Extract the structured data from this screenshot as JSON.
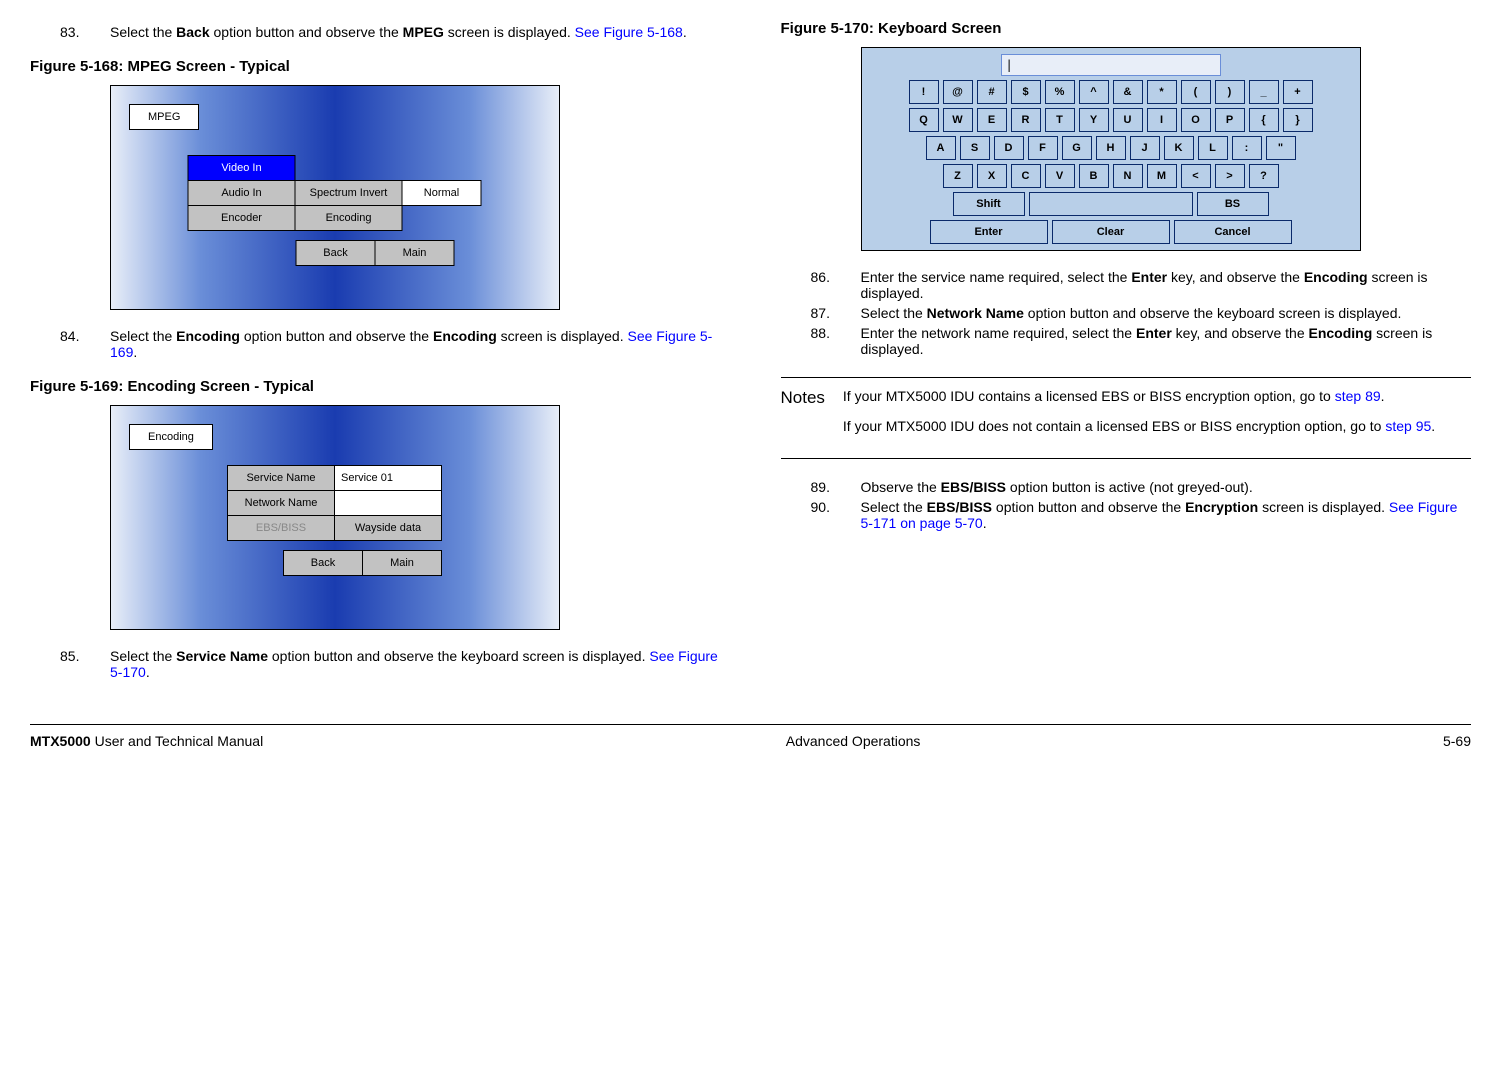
{
  "left": {
    "step83_num": "83.",
    "step83_a": "Select the ",
    "step83_b": "Back",
    "step83_c": " option button and observe the ",
    "step83_d": "MPEG",
    "step83_e": " screen is displayed.  ",
    "step83_link": "See Figure 5-168",
    "step83_dot": ".",
    "fig168": "Figure 5-168:   MPEG Screen - Typical",
    "mpeg_tag": "MPEG",
    "mpeg": {
      "video_in": "Video In",
      "audio_in": "Audio In",
      "spectrum": "Spectrum Invert",
      "normal": "Normal",
      "encoder": "Encoder",
      "encoding": "Encoding",
      "back": "Back",
      "main": "Main"
    },
    "step84_num": "84.",
    "step84_a": "Select the ",
    "step84_b": "Encoding",
    "step84_c": " option button and observe the ",
    "step84_d": "Encoding",
    "step84_e": " screen is displayed.  ",
    "step84_link": "See Figure 5-169",
    "step84_dot": ".",
    "fig169": "Figure 5-169:   Encoding Screen - Typical",
    "enc_tag": "Encoding",
    "enc": {
      "service_name": "Service Name",
      "service_val": "Service 01",
      "network_name": "Network Name",
      "ebs": "EBS/BISS",
      "wayside": "Wayside data",
      "back": "Back",
      "main": "Main"
    },
    "step85_num": "85.",
    "step85_a": "Select the ",
    "step85_b": "Service Name",
    "step85_c": " option button and observe the keyboard screen is displayed.  ",
    "step85_link": "See Figure 5-170",
    "step85_dot": "."
  },
  "right": {
    "fig170": "Figure 5-170:   Keyboard Screen",
    "cursor": "|",
    "row1": [
      "!",
      "@",
      "#",
      "$",
      "%",
      "^",
      "&",
      "*",
      "(",
      ")",
      "_",
      "+"
    ],
    "row2": [
      "Q",
      "W",
      "E",
      "R",
      "T",
      "Y",
      "U",
      "I",
      "O",
      "P",
      "{",
      "}"
    ],
    "row3": [
      "A",
      "S",
      "D",
      "F",
      "G",
      "H",
      "J",
      "K",
      "L",
      ":",
      "\""
    ],
    "row4": [
      "Z",
      "X",
      "C",
      "V",
      "B",
      "N",
      "M",
      "<",
      ">",
      "?"
    ],
    "shift": "Shift",
    "bs": "BS",
    "enter": "Enter",
    "clear": "Clear",
    "cancel": "Cancel",
    "step86_num": "86.",
    "step86_a": "Enter the service name required, select the ",
    "step86_b": "Enter",
    "step86_c": " key, and observe the ",
    "step86_d": "Encoding",
    "step86_e": " screen is displayed.",
    "step87_num": "87.",
    "step87_a": "Select the ",
    "step87_b": "Network Name",
    "step87_c": " option button and observe the keyboard screen is displayed.",
    "step88_num": "88.",
    "step88_a": "Enter the network name required, select the ",
    "step88_b": "Enter",
    "step88_c": " key, and observe the ",
    "step88_d": "Encoding",
    "step88_e": " screen is displayed.",
    "notes_label": "Notes",
    "note1_a": "If your MTX5000 IDU contains a licensed EBS or BISS encryption option, go to ",
    "note1_link": "step 89",
    "note1_dot": ".",
    "note2_a": "If your MTX5000 IDU does not contain a licensed EBS or BISS encryption option, go to ",
    "note2_link": "step 95",
    "note2_dot": ".",
    "step89_num": "89.",
    "step89_a": "Observe the ",
    "step89_b": "EBS/BISS",
    "step89_c": " option button is active (not greyed-out).",
    "step90_num": "90.",
    "step90_a": "Select the ",
    "step90_b": "EBS/BISS",
    "step90_c": " option button and observe the ",
    "step90_d": "Encryption",
    "step90_e": " screen is displayed.  ",
    "step90_link": "See Figure 5-171 on page 5-70",
    "step90_dot": "."
  },
  "footer": {
    "left_a": "MTX5000",
    "left_b": " User and Technical Manual",
    "center": "Advanced Operations",
    "right": "5-69"
  }
}
